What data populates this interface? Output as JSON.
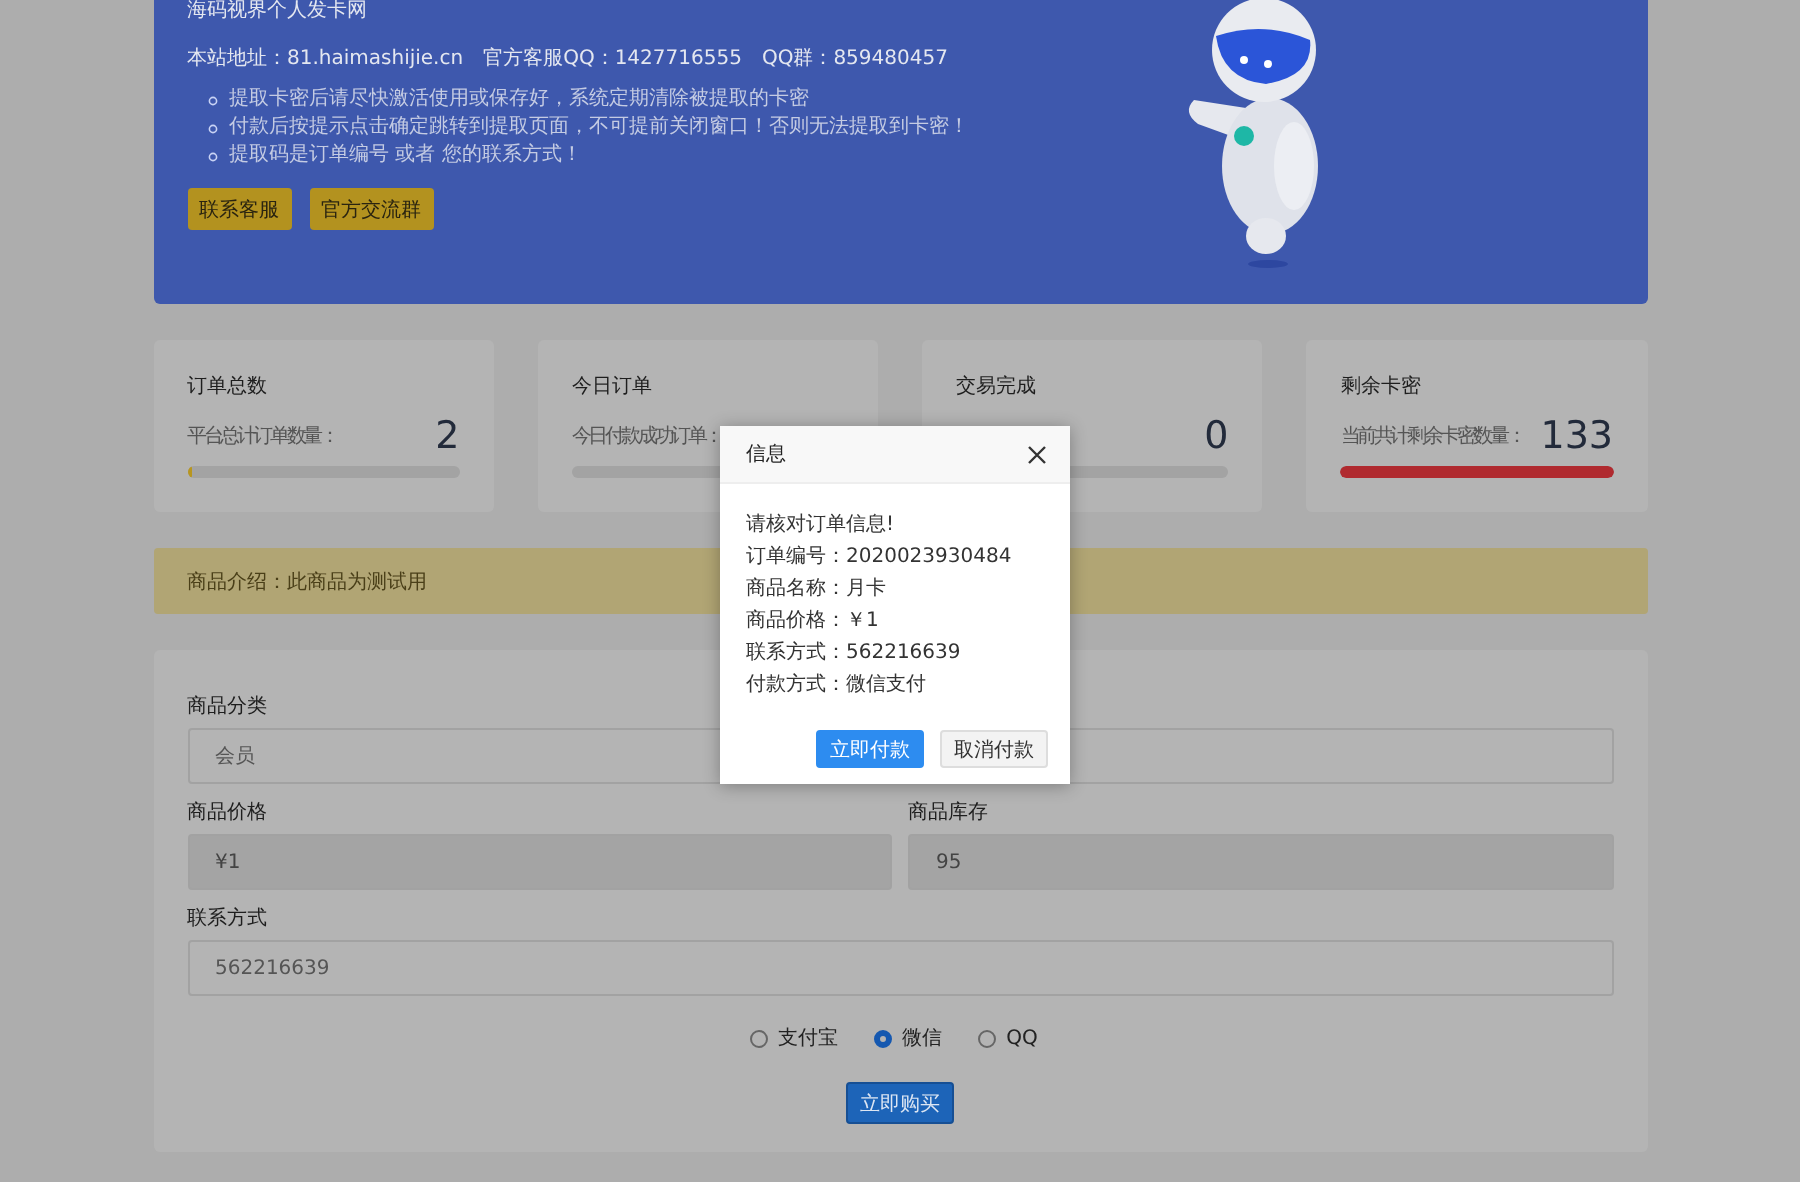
{
  "hero": {
    "title": "海码视界个人发卡网",
    "info": [
      "本站地址：81.haimashijie.cn",
      "官方客服QQ：1427716555",
      "QQ群：859480457"
    ],
    "notices": [
      "提取卡密后请尽快激活使用或保存好，系统定期清除被提取的卡密",
      "付款后按提示点击确定跳转到提取页面，不可提前关闭窗口！否则无法提取到卡密！",
      "提取码是订单编号 或者 您的联系方式！"
    ],
    "buttons": [
      "联系客服",
      "官方交流群"
    ]
  },
  "stats": [
    {
      "title": "订单总数",
      "subtitle": "平台总计订单数量：",
      "value": "2",
      "level": 0.02,
      "color": "#b8961f"
    },
    {
      "title": "今日订单",
      "subtitle": "今日付款成功订单："
    },
    {
      "title": "交易完成",
      "value": "0"
    },
    {
      "title": "剩余卡密",
      "subtitle": "当前共计剩余卡密数量：",
      "value": "133",
      "level": 1,
      "color": "#b02a2f"
    }
  ],
  "notice_bar": "商品介绍：此商品为测试用",
  "form": {
    "rows": [
      [
        {
          "kind": "select",
          "label": "商品分类",
          "value": "会员"
        },
        {
          "kind": "select"
        }
      ],
      [
        {
          "kind": "input",
          "label": "商品价格",
          "value": "¥1",
          "disabled": true
        },
        {
          "kind": "input",
          "label": "商品库存",
          "value": "95",
          "disabled": true
        }
      ],
      [
        {
          "kind": "input",
          "label": "联系方式",
          "value": "562216639",
          "disabled": false
        }
      ]
    ],
    "payments": [
      {
        "label": "支付宝",
        "selected": false
      },
      {
        "label": "微信",
        "selected": true
      },
      {
        "label": "QQ",
        "selected": false
      }
    ],
    "submit": "立即购买"
  },
  "dialog": {
    "title": "信息",
    "lines": [
      "请核对订单信息!",
      "订单编号：2020023930484",
      "商品名称：月卡",
      "商品价格：￥1",
      "联系方式：562216639",
      "付款方式：微信支付"
    ],
    "buttons": [
      {
        "label": "立即付款",
        "kind": "primary"
      },
      {
        "label": "取消付款",
        "kind": "secondary"
      }
    ]
  }
}
